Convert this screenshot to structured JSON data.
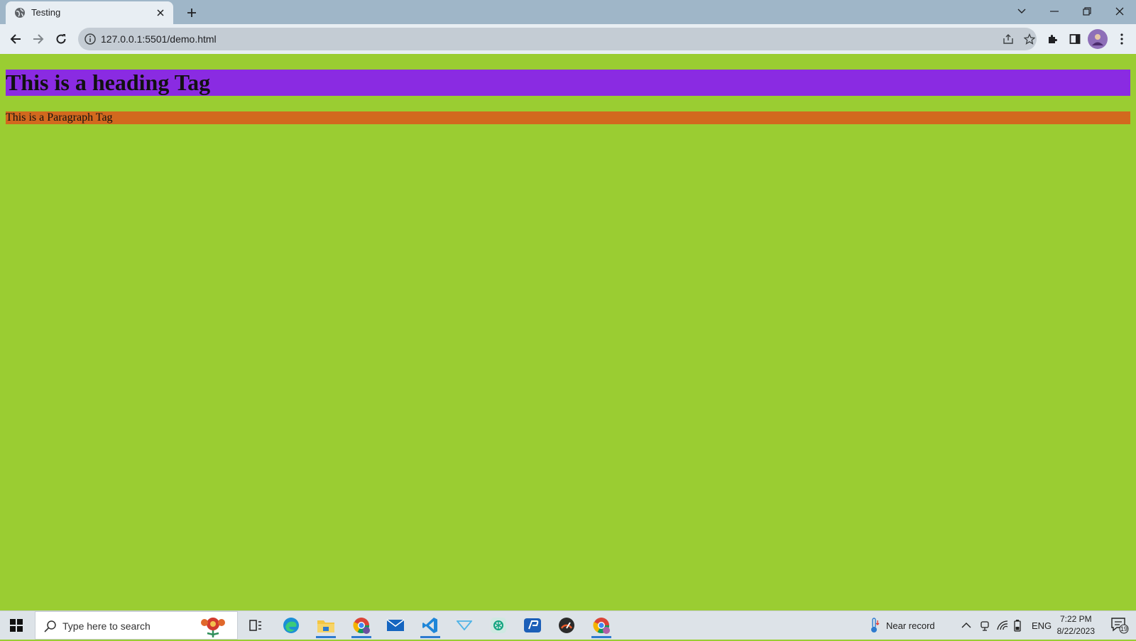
{
  "browser": {
    "tab": {
      "title": "Testing"
    },
    "address": {
      "url": "127.0.0.1:5501/demo.html"
    },
    "icons": [
      "globe-icon",
      "close-icon",
      "plus-icon",
      "chevron-down-icon",
      "minimize-icon",
      "restore-icon",
      "window-close-icon",
      "back-icon",
      "forward-icon",
      "reload-icon",
      "info-icon",
      "share-icon",
      "star-icon",
      "puzzle-icon",
      "side-panel-icon",
      "avatar",
      "kebab-menu-icon"
    ]
  },
  "page": {
    "heading": "This is a heading Tag",
    "paragraph": "This is a Paragraph Tag",
    "colors": {
      "background": "#9acd32",
      "heading_bg": "#8a2be2",
      "paragraph_bg": "#d2691e"
    }
  },
  "taskbar": {
    "search_placeholder": "Type here to search",
    "weather": "Near record",
    "language": "ENG",
    "time": "7:22 PM",
    "date": "8/22/2023",
    "notifications": "19",
    "apps": [
      "task-view-icon",
      "edge-icon",
      "file-explorer-icon",
      "chrome-profile-icon",
      "mail-icon",
      "vscode-icon",
      "vpn-icon",
      "chatgpt-icon",
      "app-icon",
      "speedtest-icon",
      "chrome-icon"
    ]
  }
}
